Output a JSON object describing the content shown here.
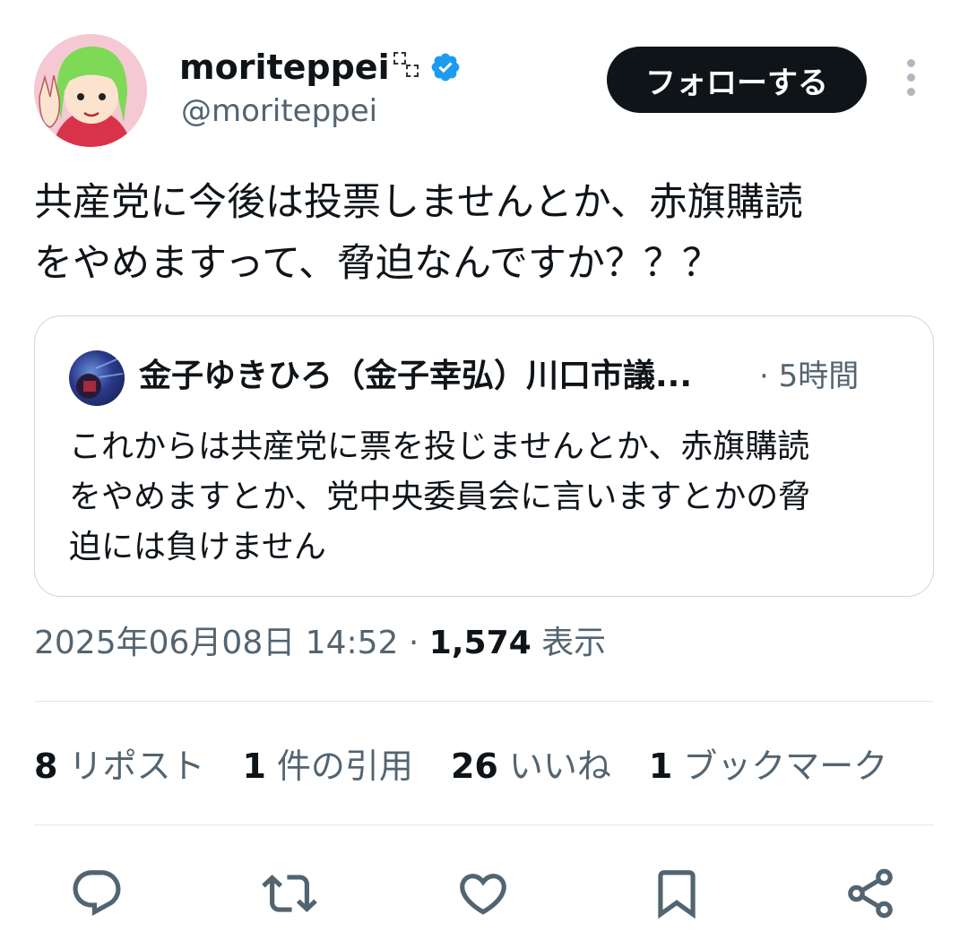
{
  "author": {
    "display_name": "moriteppei",
    "handle": "@moriteppei",
    "verified": true,
    "badge_color": "#1d9bf0"
  },
  "follow_button": {
    "label": "フォローする"
  },
  "tweet": {
    "text_line1": "共産党に今後は投票しませんとか、赤旗購読",
    "text_line2": "をやめますって、脅迫なんですか？？？"
  },
  "quote": {
    "author_name": "金子ゆきひろ（金子幸弘）川口市議...",
    "time": "· 5時間",
    "text_line1": "これからは共産党に票を投じませんとか、赤旗購読",
    "text_line2": "をやめますとか、党中央委員会に言いますとかの脅",
    "text_line3": "迫には負けません"
  },
  "meta": {
    "timestamp": "2025年06月08日 14:52",
    "separator": "·",
    "views_count": "1,574",
    "views_label": "表示"
  },
  "stats": [
    {
      "count": "8",
      "label": "リポスト"
    },
    {
      "count": "1",
      "label": "件の引用"
    },
    {
      "count": "26",
      "label": "いいね"
    },
    {
      "count": "1",
      "label": "ブックマーク"
    }
  ],
  "actions": [
    "reply-icon",
    "repost-icon",
    "like-icon",
    "bookmark-icon",
    "share-icon"
  ],
  "colors": {
    "text": "#0f1419",
    "secondary": "#536471",
    "border": "#cfd9de",
    "button_bg": "#0f1419"
  }
}
